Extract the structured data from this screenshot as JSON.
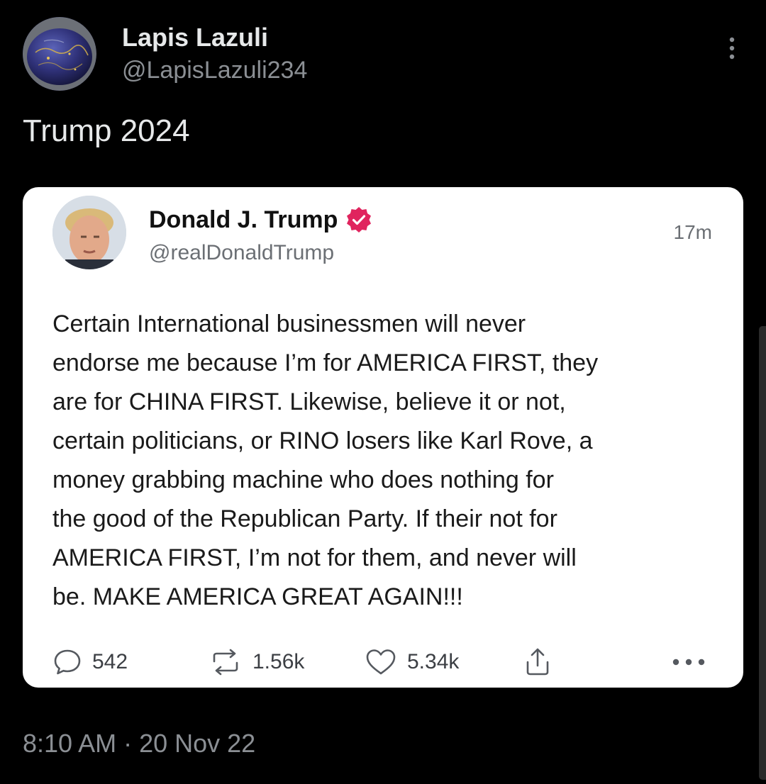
{
  "tweet": {
    "author": {
      "name": "Lapis Lazuli",
      "handle": "@LapisLazuli234",
      "avatar_icon": "lapis-stone-avatar"
    },
    "text": "Trump 2024",
    "timestamp": "8:10 AM · 20 Nov 22",
    "more_icon": "vertical-ellipsis-icon"
  },
  "embedded_post": {
    "author": {
      "name": "Donald J. Trump",
      "handle": "@realDonaldTrump",
      "verified_icon": "verified-badge-icon",
      "verified_color": "#e0245e"
    },
    "time_ago": "17m",
    "body_lines": [
      "Certain International businessmen will never",
      "endorse me because I’m for AMERICA FIRST, they",
      "are for CHINA FIRST. Likewise, believe it or not,",
      "certain politicians, or RINO losers like Karl Rove, a",
      "money grabbing machine who does nothing for",
      "the good of the Republican Party. If their not for",
      "AMERICA FIRST, I’m not for them, and never will",
      "be. MAKE AMERICA GREAT AGAIN!!!"
    ],
    "actions": {
      "replies": "542",
      "reposts": "1.56k",
      "likes": "5.34k",
      "reply_icon": "comment-bubble-icon",
      "repost_icon": "repost-arrows-icon",
      "like_icon": "heart-icon",
      "share_icon": "share-upload-icon",
      "more_icon": "horizontal-ellipsis-icon"
    }
  },
  "colors": {
    "background": "#000000",
    "primary_text": "#e7e9ea",
    "secondary_text": "#8b8f94",
    "card_background": "#ffffff"
  }
}
